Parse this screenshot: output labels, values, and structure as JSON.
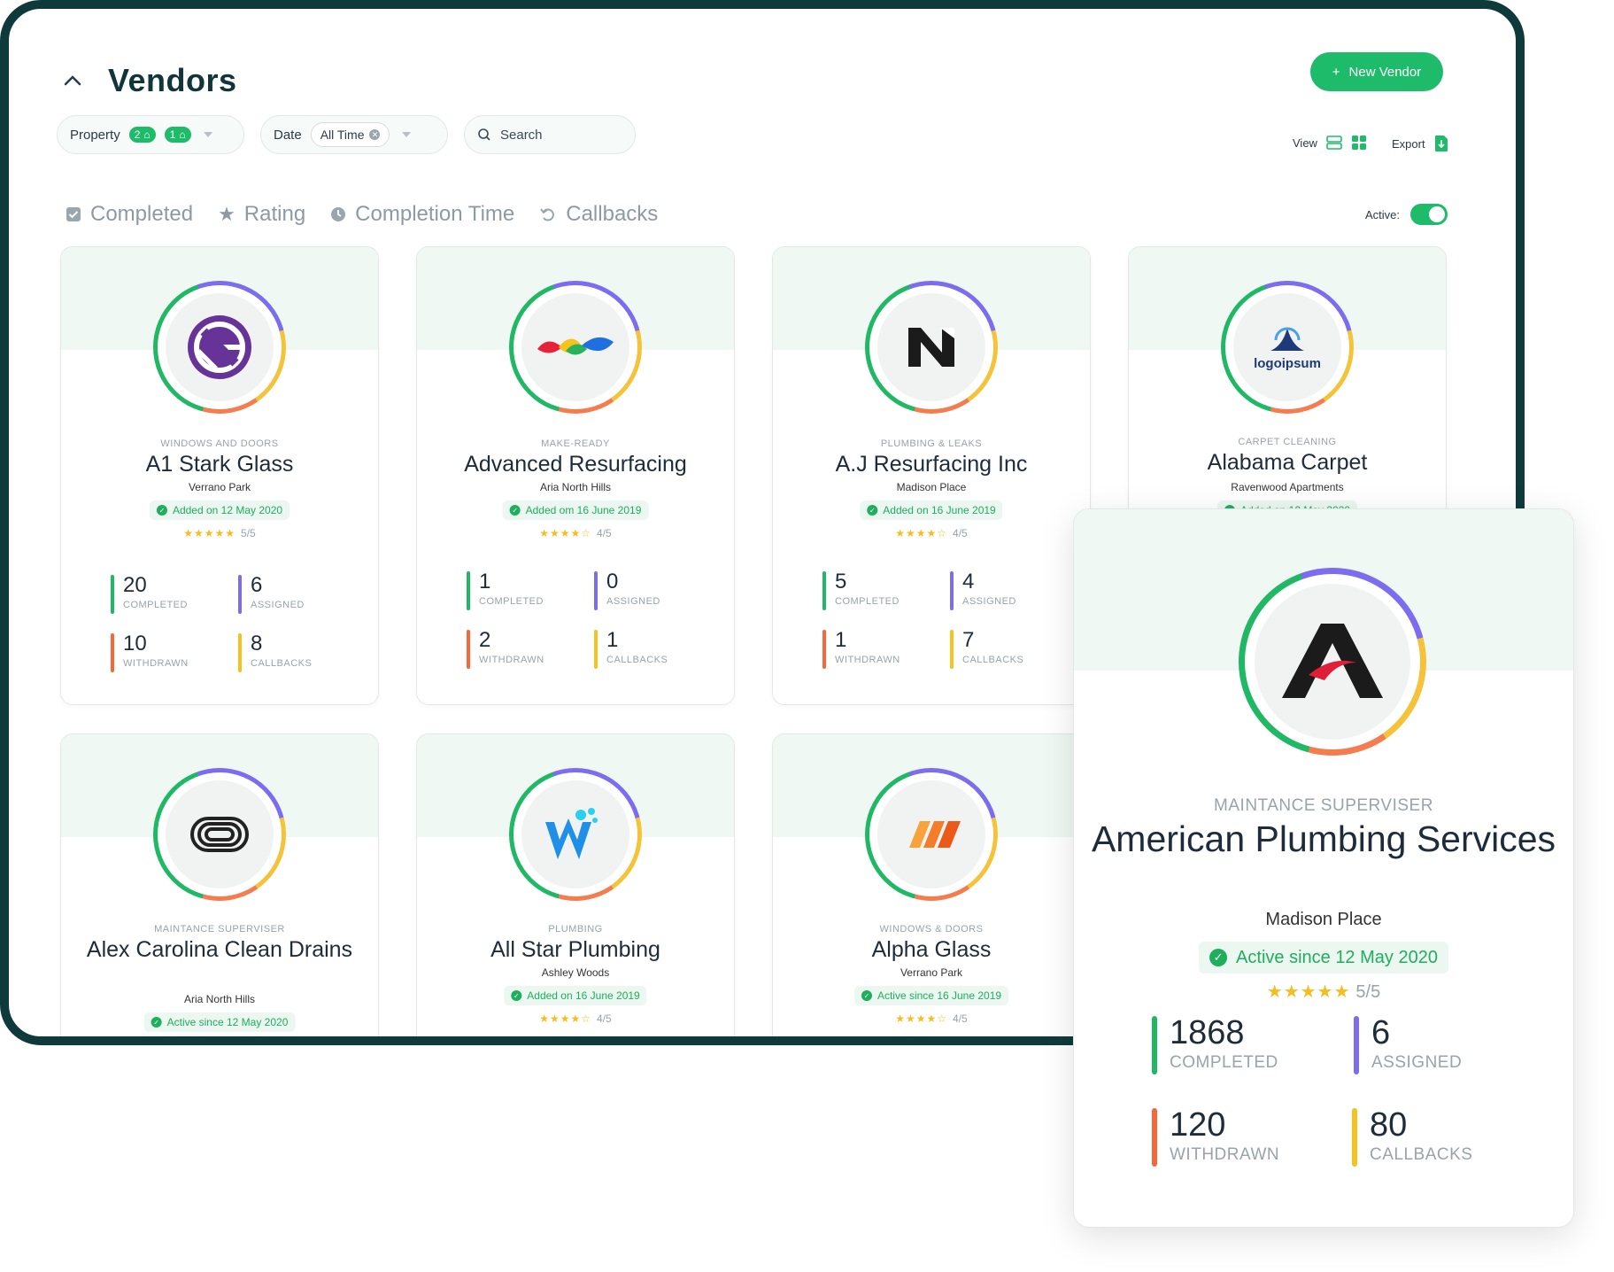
{
  "header": {
    "title": "Vendors",
    "new_vendor_label": "New Vendor"
  },
  "filters": {
    "property_label": "Property",
    "property_badge_1": "2",
    "property_badge_2": "1",
    "date_label": "Date",
    "date_value": "All Time",
    "search_placeholder": "Search"
  },
  "controls": {
    "view_label": "View",
    "export_label": "Export",
    "active_label": "Active:"
  },
  "sorts": [
    "Completed",
    "Rating",
    "Completion Time",
    "Callbacks"
  ],
  "colors": {
    "accent": "#1ebc6a",
    "frame": "#0f3a3c",
    "completed": "#20b865",
    "assigned": "#7c6cf0",
    "withdrawn": "#f4683a",
    "callbacks": "#f5c21f"
  },
  "stat_labels": {
    "completed": "COMPLETED",
    "assigned": "ASSIGNED",
    "withdrawn": "WITHDRAWN",
    "callbacks": "CALLBACKS"
  },
  "vendors": [
    {
      "category": "WINDOWS AND DOORS",
      "name": "A1 Stark Glass",
      "location": "Verrano Park",
      "added": "Added on 12 May 2020",
      "rating": "5/5",
      "stars": 5,
      "completed": "20",
      "assigned": "6",
      "withdrawn": "10",
      "callbacks": "8",
      "logo": "gatsby-logo-icon"
    },
    {
      "category": "MAKE-READY",
      "name": "Advanced Resurfacing",
      "location": "Aria North Hills",
      "added": "Added om 16 June 2019",
      "rating": "4/5",
      "stars": 4,
      "completed": "1",
      "assigned": "0",
      "withdrawn": "2",
      "callbacks": "1",
      "logo": "colorful-leaves-logo-icon"
    },
    {
      "category": "PLUMBING & LEAKS",
      "name": "A.J Resurfacing Inc",
      "location": "Madison Place",
      "added": "Added on 16 June 2019",
      "rating": "4/5",
      "stars": 4,
      "completed": "5",
      "assigned": "4",
      "withdrawn": "1",
      "callbacks": "7",
      "logo": "n-letter-logo-icon"
    },
    {
      "category": "CARPET CLEANING",
      "name": "Alabama Carpet",
      "location": "Ravenwood Apartments",
      "added": "Added on 12 May 2020",
      "logo": "logoipsum-logo-icon",
      "logo_text": "logoipsum"
    },
    {
      "category": "MAINTANCE SUPERVISER",
      "name": "Alex Carolina Clean Drains",
      "location": "Aria North Hills",
      "added": "Active since 12 May 2020",
      "logo": "loop-lines-logo-icon"
    },
    {
      "category": "PLUMBING",
      "name": "All Star Plumbing",
      "location": "Ashley Woods",
      "added": "Added on 16 June 2019",
      "rating": "4/5",
      "stars": 4,
      "logo": "w-splash-logo-icon"
    },
    {
      "category": "WINDOWS & DOORS",
      "name": "Alpha Glass",
      "location": "Verrano Park",
      "added": "Active since 16 June 2019",
      "rating": "4/5",
      "stars": 4,
      "logo": "orange-stripes-logo-icon"
    }
  ],
  "featured": {
    "category": "MAINTANCE SUPERVISER",
    "name": "American Plumbing Services",
    "location": "Madison Place",
    "added": "Active since 12 May 2020",
    "rating": "5/5",
    "stars": 5,
    "completed": "1868",
    "assigned": "6",
    "withdrawn": "120",
    "callbacks": "80",
    "logo": "a-letter-logo-icon"
  }
}
